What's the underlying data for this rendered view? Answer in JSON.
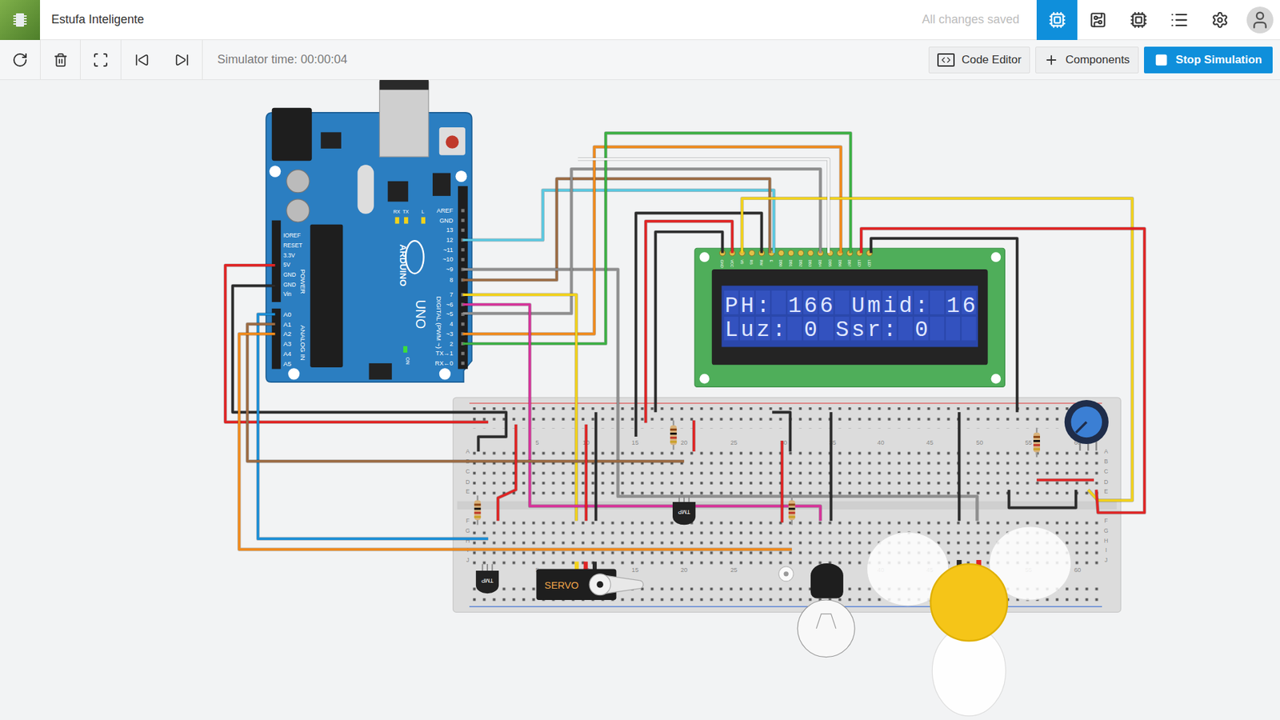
{
  "window": {
    "title": "Estufa Inteligente"
  },
  "header": {
    "status": "All changes saved",
    "views": [
      {
        "selected": true
      },
      {
        "selected": false
      },
      {
        "selected": false
      }
    ]
  },
  "toolbar": {
    "simulator_time": "Simulator time: 00:00:04",
    "buttons": [
      "Code Editor",
      "Components",
      "Stop Simulation"
    ]
  },
  "arduino": {
    "brand": "ARDUINO",
    "model": "UNO",
    "digital_label": "DIGITAL (PWM ~)",
    "power_label": "POWER",
    "analog_label": "ANALOG IN",
    "on_label": "ON",
    "leds": [
      "L",
      "TX",
      "RX"
    ],
    "power_pins": [
      "IOREF",
      "RESET",
      "3.3V",
      "5V",
      "GND",
      "GND",
      "Vin"
    ],
    "analog_pins": [
      "A0",
      "A1",
      "A2",
      "A3",
      "A4",
      "A5"
    ],
    "digital_pins": [
      "AREF",
      "GND",
      "13",
      "12",
      "~11",
      "~10",
      "~9",
      "8",
      "7",
      "~6",
      "~5",
      "4",
      "~3",
      "2",
      "TX→1",
      "RX←0"
    ]
  },
  "lcd": {
    "lines": [
      "PH: 166 Umid: 16",
      "Luz: 0 Ssr: 0"
    ],
    "pins": [
      "GND",
      "VCC",
      "V0",
      "RS",
      "RW",
      "E",
      "DB0",
      "DB1",
      "DB2",
      "DB3",
      "DB4",
      "DB5",
      "DB6",
      "DB7",
      "LED",
      "LED"
    ]
  },
  "breadboard": {
    "columns": [
      "5",
      "10",
      "15",
      "20",
      "25",
      "30",
      "35",
      "40",
      "45",
      "50",
      "55",
      "60"
    ],
    "rows": [
      "A",
      "B",
      "C",
      "D",
      "E",
      "F",
      "G",
      "H",
      "I",
      "J"
    ]
  },
  "parts": {
    "servo": "SERVO",
    "sensors": [
      "TMP",
      "TMP"
    ]
  },
  "wires": [
    {
      "color": "#5ac8e0"
    },
    {
      "color": "#9b6b43"
    },
    {
      "color": "#8f8f8f"
    },
    {
      "color": "#8f8f8f"
    },
    {
      "color": "#f08a1c"
    },
    {
      "color": "#3cb043"
    },
    {
      "color": "#f2d21b"
    },
    {
      "color": "#d6339a"
    },
    {
      "color": "#e02424"
    },
    {
      "color": "#2b2b2b"
    },
    {
      "color": "#1b8ed6"
    },
    {
      "color": "#9b6b43"
    },
    {
      "color": "#f08a1c"
    },
    {
      "color": "#2b2b2b"
    },
    {
      "color": "#e02424"
    },
    {
      "color": "#2b2b2b"
    },
    {
      "color": "#f2d21b"
    },
    {
      "color": "#e02424"
    },
    {
      "color": "#2b2b2b"
    },
    {
      "color": "#2b2b2b"
    },
    {
      "color": "#e02424"
    },
    {
      "color": "#2b2b2b"
    },
    {
      "color": "#2b2b2b"
    },
    {
      "color": "#e02424"
    },
    {
      "color": "#2b2b2b"
    },
    {
      "color": "#e02424"
    },
    {
      "color": "#2b2b2b"
    },
    {
      "color": "#e02424"
    },
    {
      "color": "#e02424"
    },
    {
      "color": "#f4f4f4"
    }
  ]
}
